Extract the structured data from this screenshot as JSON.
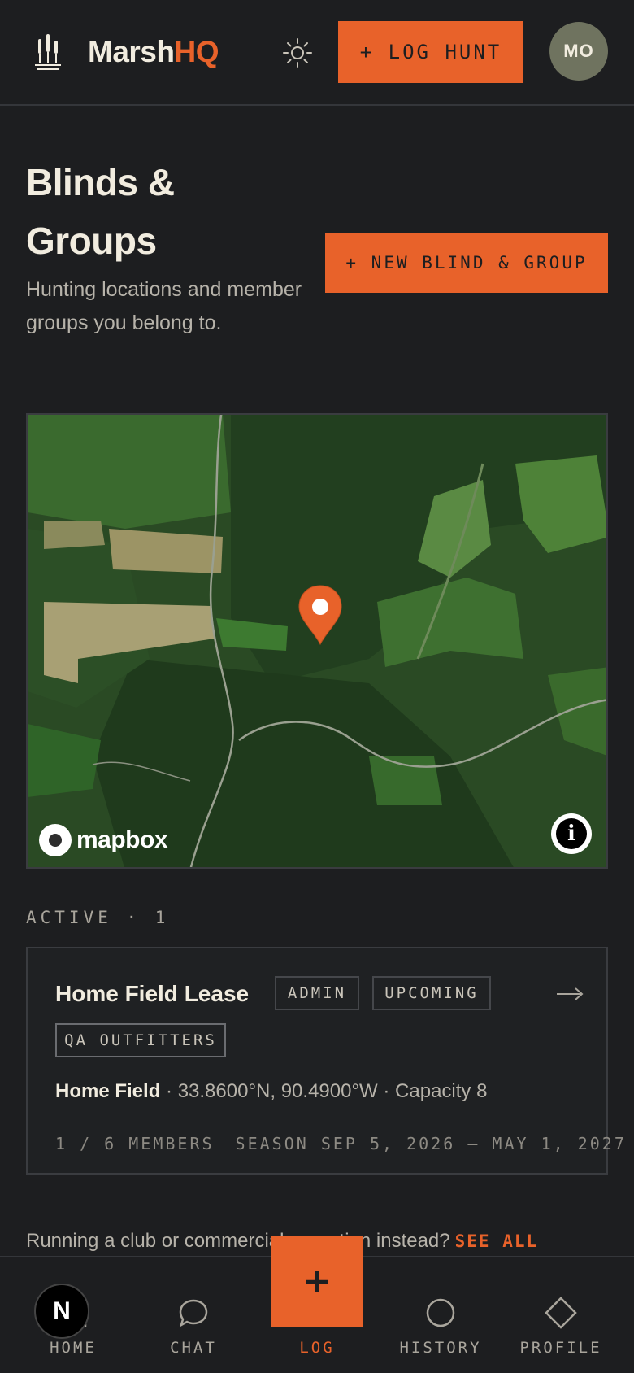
{
  "header": {
    "brand_part1": "Marsh",
    "brand_part2": "HQ",
    "log_hunt_label": "+ LOG HUNT",
    "avatar_initials": "MO"
  },
  "page": {
    "title": "Blinds & Groups",
    "subtitle": "Hunting locations and member groups you belong to.",
    "new_button_label": "+ NEW BLIND & GROUP"
  },
  "map": {
    "attribution_label": "mapbox",
    "info_label": "i"
  },
  "active_section": {
    "label": "ACTIVE · 1"
  },
  "groups": [
    {
      "name": "Home Field Lease",
      "tags": [
        "ADMIN",
        "UPCOMING",
        "QA OUTFITTERS"
      ],
      "location_name": "Home Field",
      "location_details": " · 33.8600°N, 90.4900°W · Capacity 8",
      "members": "1 / 6 MEMBERS",
      "season": "SEASON SEP 5, 2026 – MAY 1, 2027",
      "arrow": "→"
    }
  ],
  "footer_prompt": {
    "text": "Running a club or commercial operation instead?",
    "link_label": "SEE ALL"
  },
  "bottom_nav": {
    "items": [
      {
        "label": "HOME",
        "icon": "home-icon"
      },
      {
        "label": "CHAT",
        "icon": "chat-icon"
      },
      {
        "label": "LOG",
        "icon": "plus-icon"
      },
      {
        "label": "HISTORY",
        "icon": "history-icon"
      },
      {
        "label": "PROFILE",
        "icon": "profile-diamond-icon"
      }
    ],
    "dev_badge": "N"
  },
  "colors": {
    "background": "#1d1e20",
    "accent": "#e8622a",
    "text": "#f1ecdf",
    "muted": "#b7b3aa"
  }
}
